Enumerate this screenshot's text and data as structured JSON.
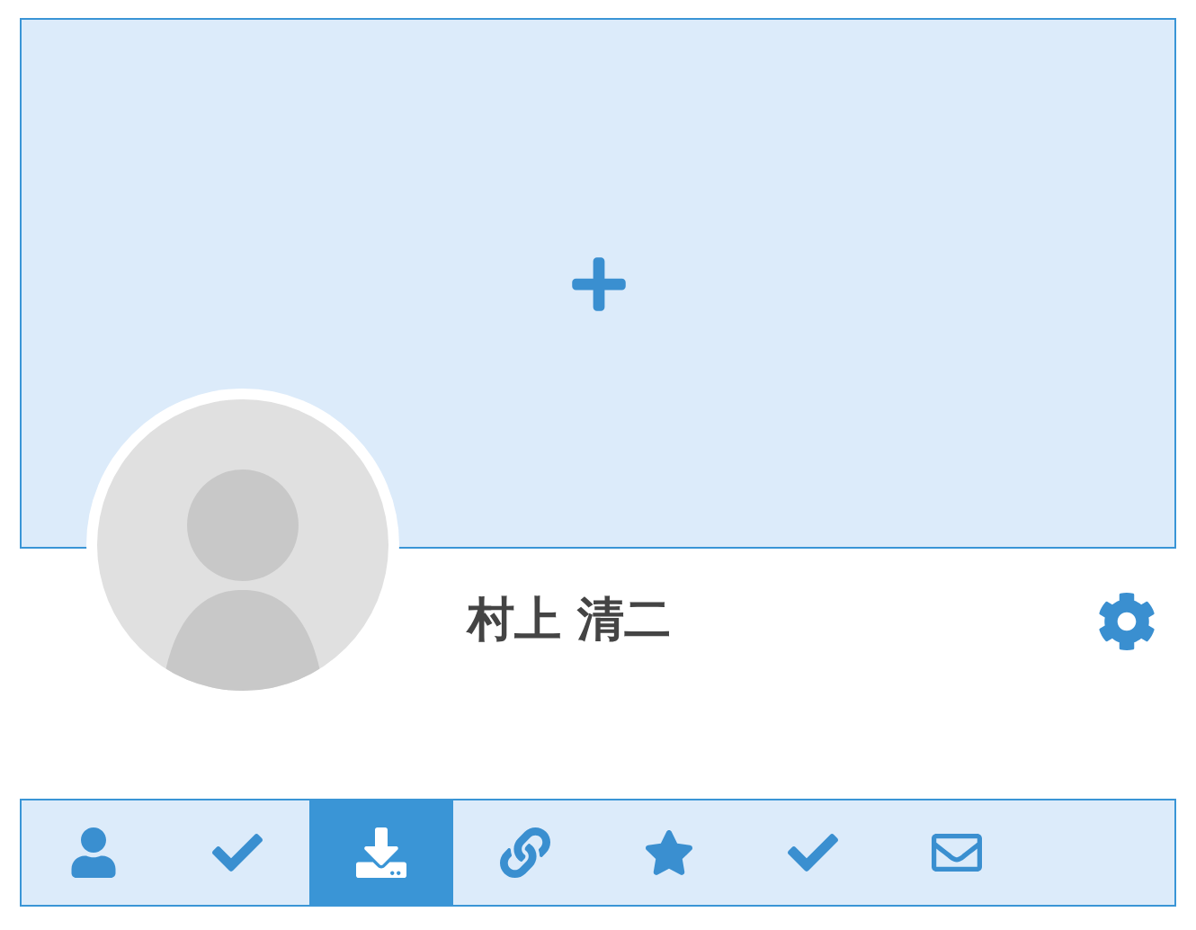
{
  "profile": {
    "name": "村上 清二"
  },
  "tabs": [
    {
      "selected": false
    },
    {
      "selected": false
    },
    {
      "selected": true
    },
    {
      "selected": false
    },
    {
      "selected": false
    },
    {
      "selected": false
    },
    {
      "selected": false
    }
  ]
}
